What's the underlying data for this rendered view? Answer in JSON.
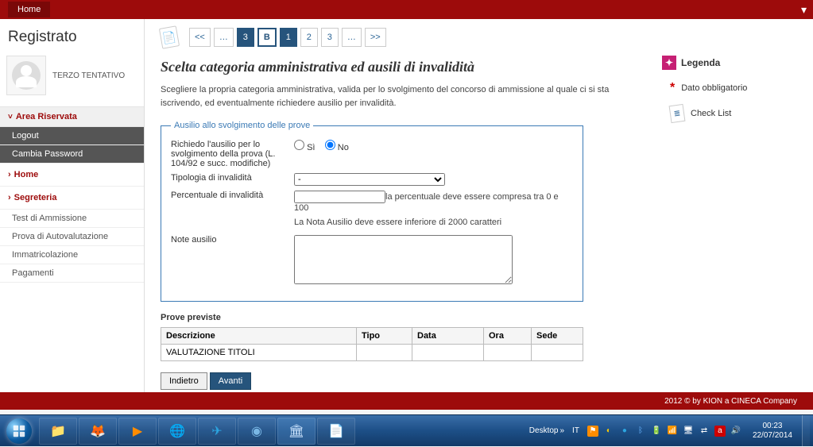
{
  "topbar": {
    "home": "Home"
  },
  "sidebar": {
    "registered": "Registrato",
    "username": "TERZO TENTATIVO",
    "area_riservata": "Area Riservata",
    "logout": "Logout",
    "cambia_password": "Cambia Password",
    "home": "Home",
    "segreteria": "Segreteria",
    "items": {
      "test": "Test di Ammissione",
      "prova": "Prova di Autovalutazione",
      "immatricolazione": "Immatricolazione",
      "pagamenti": "Pagamenti"
    }
  },
  "pagination": {
    "first": "<<",
    "prev_dots": "…",
    "p3a": "3",
    "pB": "B",
    "p1": "1",
    "p2": "2",
    "p3b": "3",
    "next_dots": "…",
    "last": ">>"
  },
  "main": {
    "title": "Scelta categoria amministrativa ed ausili di invalidità",
    "desc": "Scegliere la propria categoria amministrativa, valida per lo svolgimento del concorso di ammissione al quale ci si sta iscrivendo, ed eventualmente richiedere ausilio per invalidità.",
    "fieldset_legend": "Ausilio allo svolgimento delle prove",
    "ausilio_label": "Richiedo l'ausilio per lo svolgimento della prova (L. 104/92 e succ. modifiche)",
    "opt_si": "Sì",
    "opt_no": "No",
    "tipologia_label": "Tipologia di invalidità",
    "tipologia_value": "-",
    "percentuale_label": "Percentuale di invalidità",
    "percentuale_value": "",
    "percentuale_hint": "la percentuale deve essere compresa tra 0 e 100",
    "note_hint": "La Nota Ausilio deve essere inferiore di 2000 caratteri",
    "note_label": "Note ausilio",
    "note_value": ""
  },
  "prove": {
    "title": "Prove previste",
    "headers": {
      "descrizione": "Descrizione",
      "tipo": "Tipo",
      "data": "Data",
      "ora": "Ora",
      "sede": "Sede"
    },
    "rows": [
      {
        "descrizione": "VALUTAZIONE TITOLI",
        "tipo": "",
        "data": "",
        "ora": "",
        "sede": ""
      }
    ]
  },
  "buttons": {
    "indietro": "Indietro",
    "avanti": "Avanti"
  },
  "legend": {
    "title": "Legenda",
    "dato": "Dato obbligatorio",
    "checklist": "Check List"
  },
  "footer": {
    "copyright": "2012 © by KION a CINECA Company"
  },
  "taskbar": {
    "desktop": "Desktop",
    "lang": "IT",
    "time": "00:23",
    "date": "22/07/2014"
  }
}
